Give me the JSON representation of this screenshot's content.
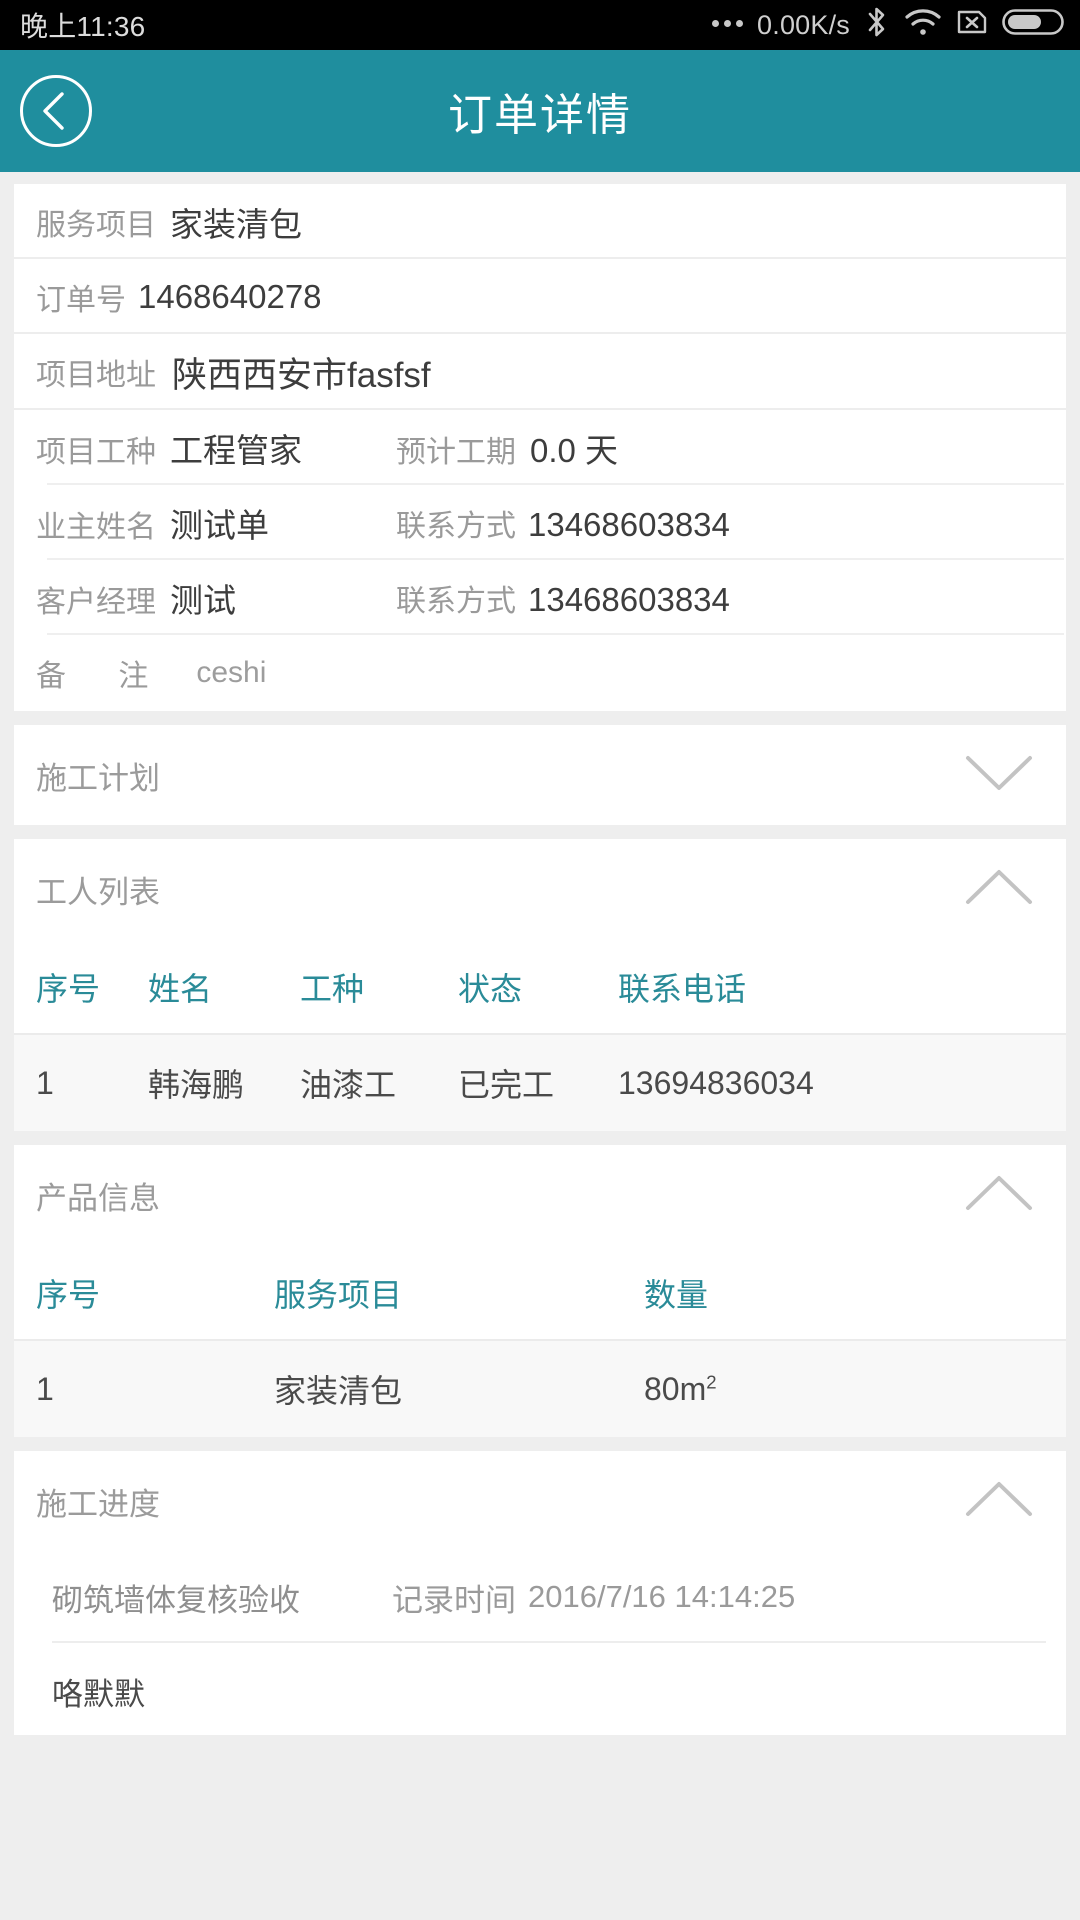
{
  "status_bar": {
    "time": "晚上11:36",
    "dots_icon": "more-dots-icon",
    "network_speed": "0.00K/s",
    "bluetooth_icon": "bluetooth-icon",
    "wifi_icon": "wifi-icon",
    "sim_icon": "sim-card-disabled-icon",
    "battery_icon": "battery-icon"
  },
  "titlebar": {
    "back_icon": "back-chevron-icon",
    "title": "订单详情",
    "background_color": "#1f8e9e",
    "text_color": "#ffffff"
  },
  "order_info": {
    "rows": [
      {
        "label": "服务项目",
        "value": "家装清包"
      },
      {
        "label": "订单号",
        "value": "1468640278"
      },
      {
        "label": "项目地址",
        "value": "陕西西安市fasfsf"
      }
    ],
    "pair_rows": [
      {
        "label_a": "项目工种",
        "value_a": "工程管家",
        "label_b": "预计工期",
        "value_b": "0.0 天"
      },
      {
        "label_a": "业主姓名",
        "value_a": "测试单",
        "label_b": "联系方式",
        "value_b": "13468603834"
      },
      {
        "label_a": "客户经理",
        "value_a": "测试",
        "label_b": "联系方式",
        "value_b": "13468603834"
      }
    ],
    "remark": {
      "label": "备 注",
      "value": "ceshi"
    }
  },
  "sections": {
    "plan": {
      "title": "施工计划",
      "chevron": "chevron-down-icon",
      "expanded": false
    },
    "workers": {
      "title": "工人列表",
      "chevron": "chevron-up-icon",
      "expanded": true
    },
    "products": {
      "title": "产品信息",
      "chevron": "chevron-up-icon",
      "expanded": true
    },
    "progress": {
      "title": "施工进度",
      "chevron": "chevron-up-icon",
      "expanded": true
    }
  },
  "worker_table": {
    "headers": [
      "序号",
      "姓名",
      "工种",
      "状态",
      "联系电话"
    ],
    "rows": [
      {
        "index": "1",
        "name": "韩海鹏",
        "trade": "油漆工",
        "status": "已完工",
        "phone": "13694836034"
      }
    ]
  },
  "product_table": {
    "headers": [
      "序号",
      "服务项目",
      "数量"
    ],
    "rows": [
      {
        "index": "1",
        "item": "家装清包",
        "qty_number": "80m",
        "qty_unit": "2"
      }
    ]
  },
  "progress_list": {
    "rows": [
      {
        "name": "砌筑墙体复核验收",
        "time_label": "记录时间",
        "time_value": "2016/7/16 14:14:25"
      }
    ],
    "partial_row": {
      "name": "咯默默"
    }
  },
  "colors": {
    "accent_teal": "#1f8e9e",
    "table_header_teal": "#2a8b98",
    "page_background": "#eeeeee",
    "card_background": "#ffffff",
    "row_alt_background": "#f8f8f8"
  }
}
